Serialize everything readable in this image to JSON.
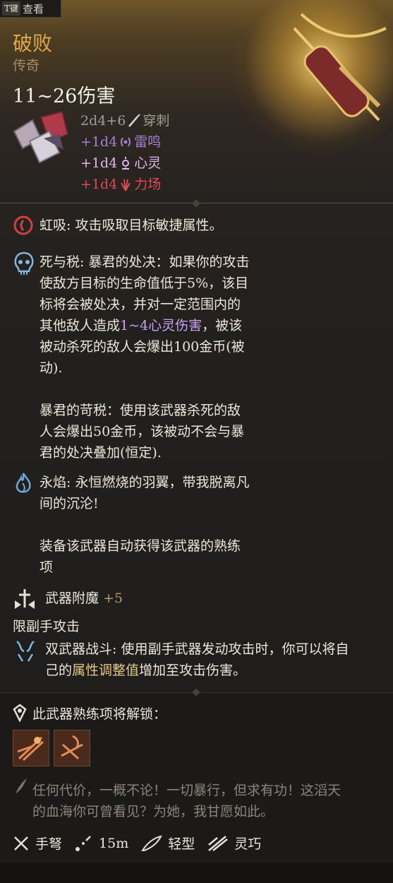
{
  "topbar": {
    "key_label": "T键",
    "action_label": "查看"
  },
  "item": {
    "name": "破败",
    "rarity": "传奇",
    "damage_summary": "11~26伤害"
  },
  "damage_lines": [
    {
      "dice": "2d4+6",
      "type": "穿刺",
      "color": "#a49d93",
      "icon": "pierce-icon"
    },
    {
      "dice": "+1d4",
      "type": "雷鸣",
      "color": "#a77ed6",
      "icon": "thunder-icon"
    },
    {
      "dice": "+1d4",
      "type": "心灵",
      "color": "#e2b8ec",
      "icon": "psychic-icon"
    },
    {
      "dice": "+1d4",
      "type": "力场",
      "color": "#e04a4e",
      "icon": "force-icon"
    }
  ],
  "passives": {
    "rainbow_drain": {
      "name": "虹吸",
      "desc": "攻击吸取目标敏捷属性。"
    },
    "death_tax": {
      "name": "死与税",
      "line1": "暴君的处决：如果你的攻击",
      "line2": "使敌方目标的生命值低于5%，该目",
      "line3": "标将会被处决，并对一定范围内的",
      "line4_pre": "其他敌人造成",
      "line4_hl": "1~4心灵伤害",
      "line4_post": "，被该",
      "line5": "被动杀死的敌人会爆出100金币(被",
      "line6": "动).",
      "line7": "暴君的苛税：使用该武器杀死的敌",
      "line8": "人会爆出50金币，该被动不会与暴",
      "line9": "君的处决叠加(恒定)."
    },
    "eternal_flame": {
      "name": "永焰",
      "line1": "永恒燃烧的羽翼，带我脱离凡",
      "line2": "间的沉沦!",
      "line3": "装备该武器自动获得该武器的熟练",
      "line4": "项"
    },
    "weapon_enchant": {
      "name": "武器附魔",
      "value": "+5"
    },
    "offhand_note": "限副手攻击",
    "dual_wield": {
      "name": "双武器战斗",
      "line1": "使用副手武器发动攻击时，你可以将自",
      "line2_pre": "己的",
      "line2_hl": "属性调整值",
      "line2_post": "增加至攻击伤害。"
    }
  },
  "proficiency": {
    "header": "此武器熟练项将解锁：",
    "actions": [
      "proficiency-action-1",
      "proficiency-action-2"
    ]
  },
  "flavor": {
    "line1": "任何代价，一概不论！一切暴行，但求有功！这滔天",
    "line2": "的血海你可曾看见？为她，我甘愿如此。"
  },
  "properties": [
    {
      "label": "手弩",
      "icon": "hand-crossbow-icon"
    },
    {
      "label": "15m",
      "icon": "range-icon"
    },
    {
      "label": "轻型",
      "icon": "light-feather-icon"
    },
    {
      "label": "灵巧",
      "icon": "finesse-icon"
    }
  ]
}
